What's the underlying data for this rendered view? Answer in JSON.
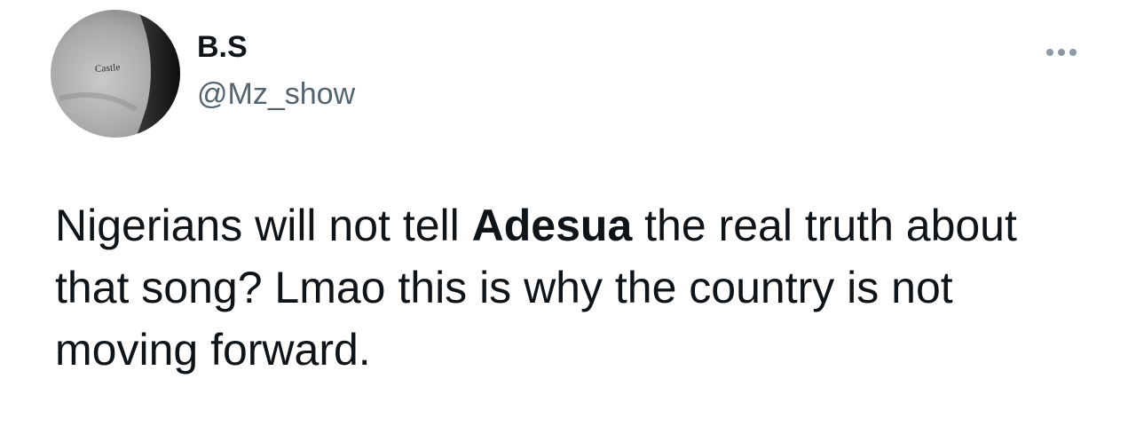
{
  "tweet": {
    "avatar_text": "Castle",
    "display_name": "B.S",
    "handle": "@Mz_show",
    "text_before": "Nigerians will not tell ",
    "text_bold": "Adesua",
    "text_after": " the real truth about that song? Lmao this is why the country is not moving forward."
  },
  "icons": {
    "more": "more-horizontal-icon"
  }
}
